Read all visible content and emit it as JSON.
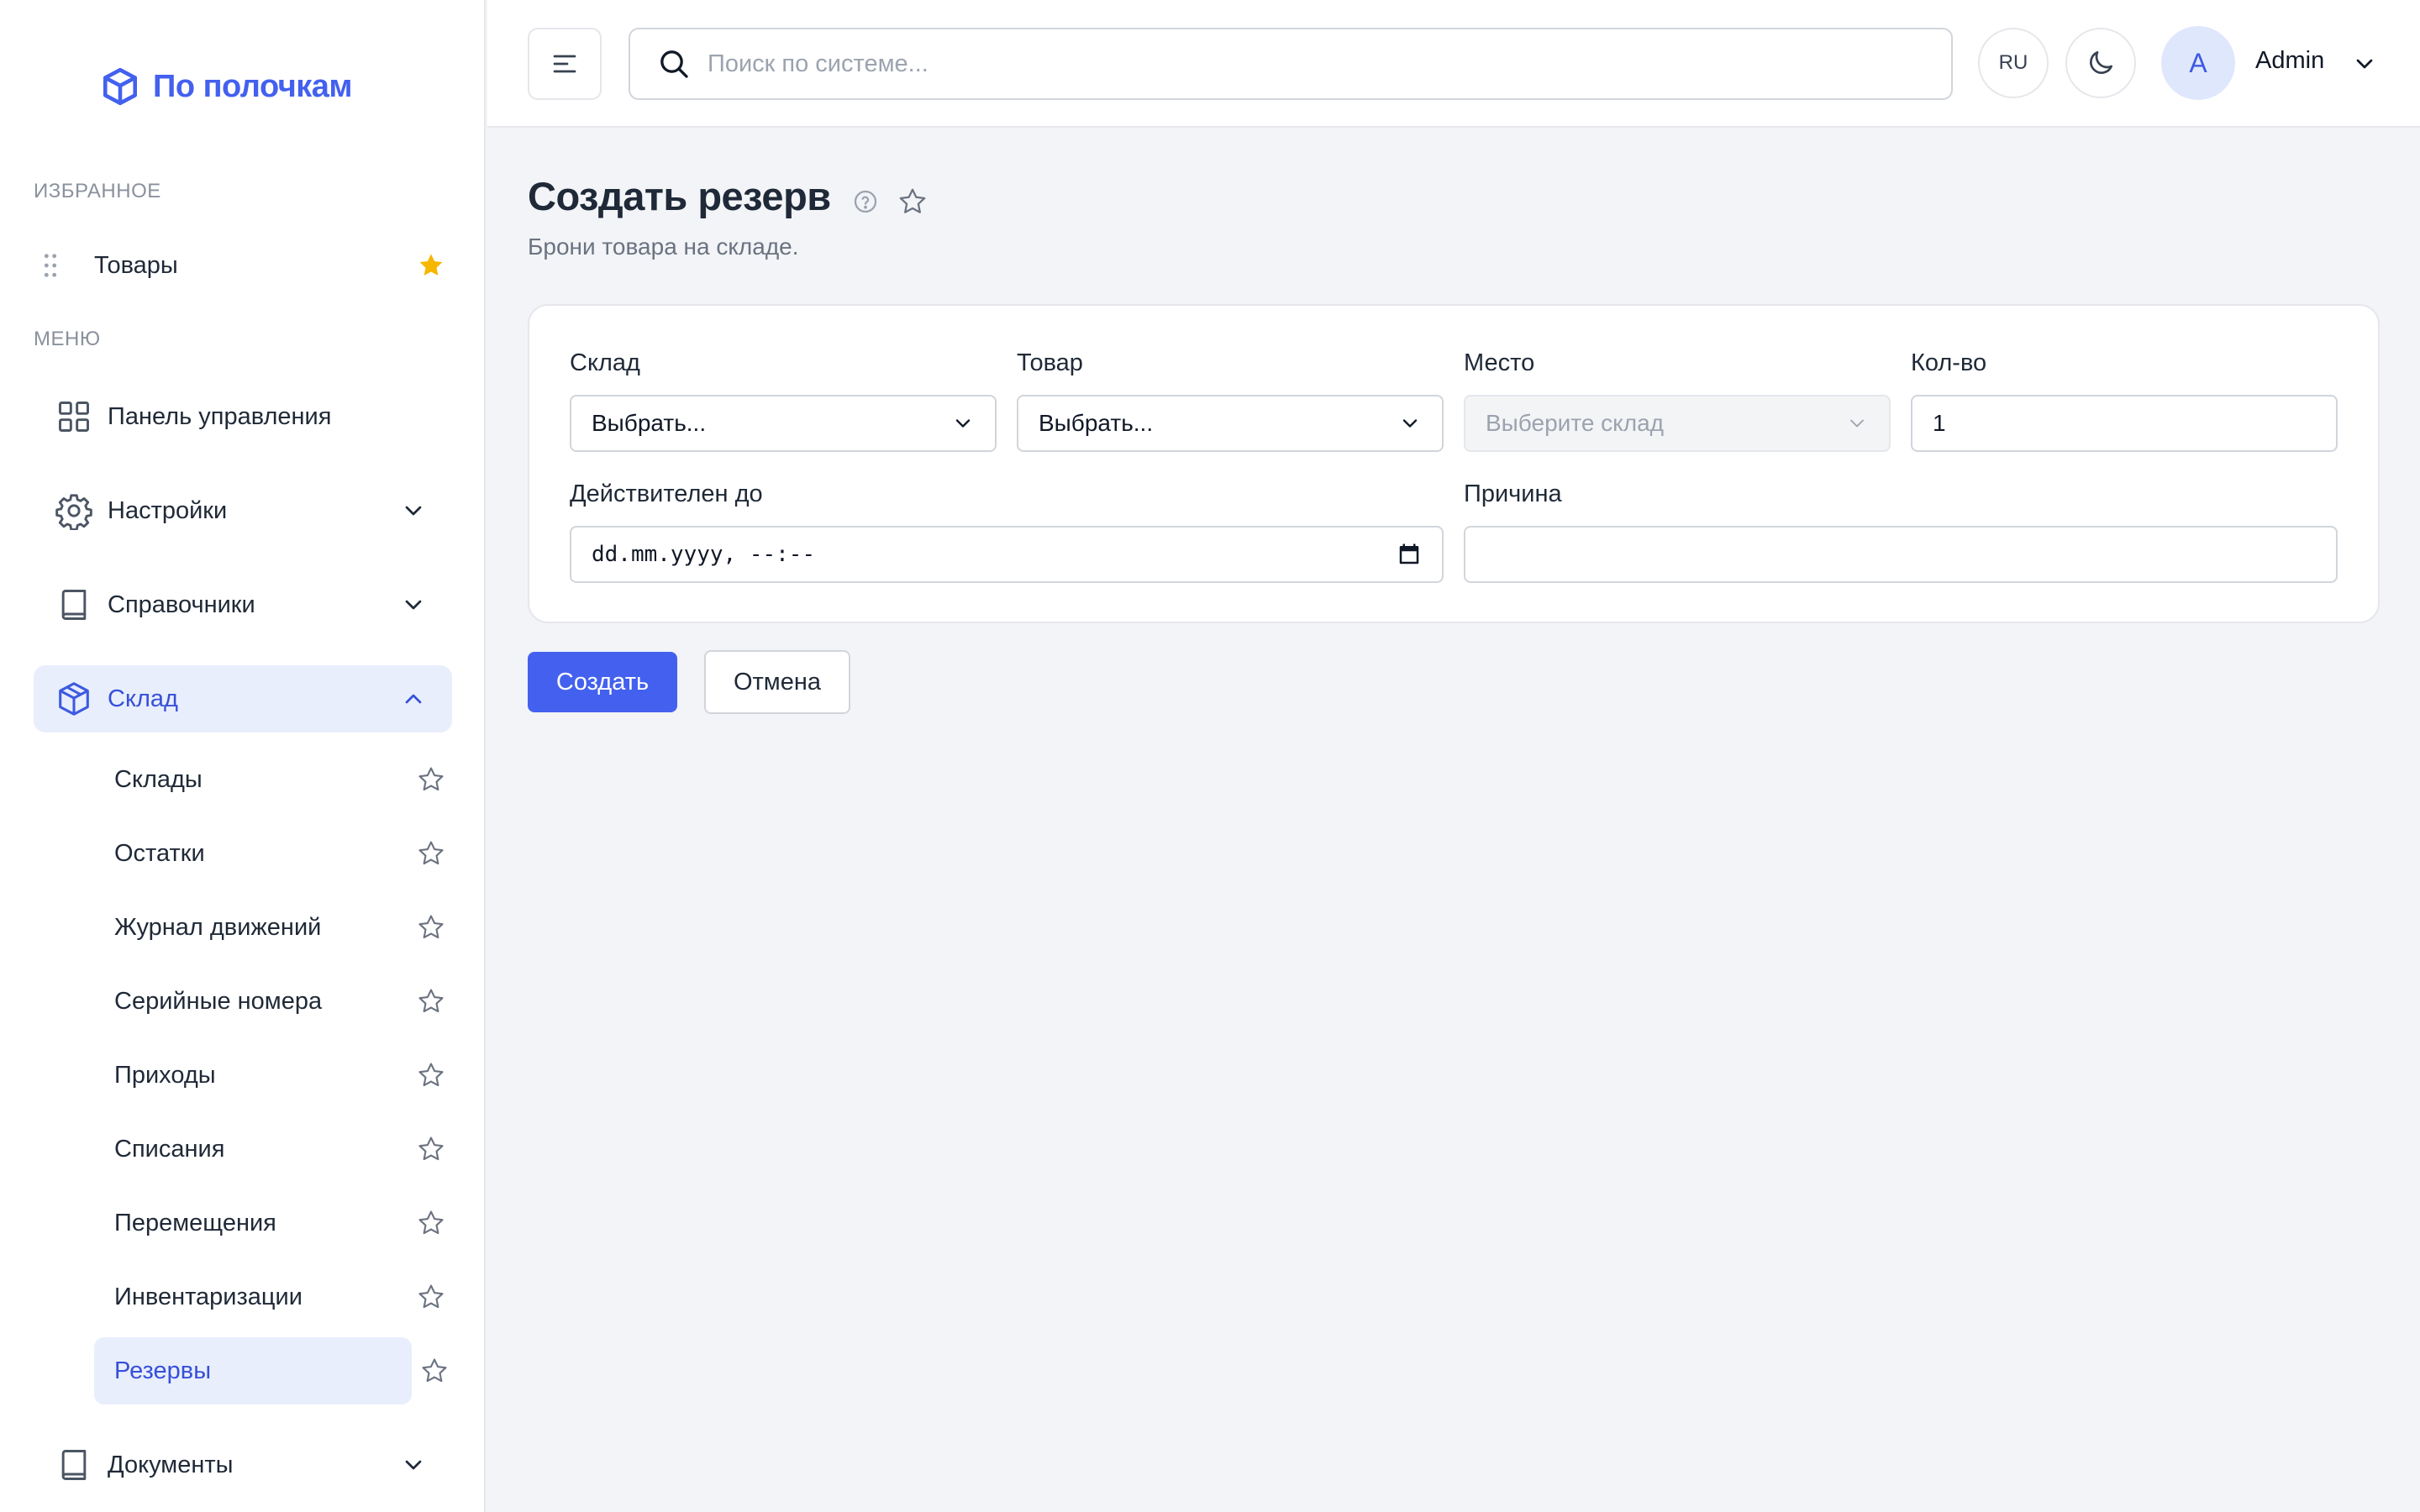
{
  "app": {
    "name": "По полочкам"
  },
  "sidebar": {
    "favorites_label": "ИЗБРАННОЕ",
    "favorites": [
      {
        "label": "Товары",
        "starred": true
      }
    ],
    "menu_label": "МЕНЮ",
    "items": [
      {
        "label": "Панель управления",
        "icon": "grid-icon"
      },
      {
        "label": "Настройки",
        "icon": "gear-icon",
        "expandable": true
      },
      {
        "label": "Справочники",
        "icon": "book-icon",
        "expandable": true
      },
      {
        "label": "Склад",
        "icon": "box-icon",
        "expandable": true,
        "expanded": true,
        "active": true
      },
      {
        "label": "Документы",
        "icon": "book-icon",
        "expandable": true
      }
    ],
    "warehouse_sub": [
      {
        "label": "Склады"
      },
      {
        "label": "Остатки"
      },
      {
        "label": "Журнал движений"
      },
      {
        "label": "Серийные номера"
      },
      {
        "label": "Приходы"
      },
      {
        "label": "Списания"
      },
      {
        "label": "Перемещения"
      },
      {
        "label": "Инвентаризации"
      },
      {
        "label": "Резервы",
        "active": true
      }
    ]
  },
  "topbar": {
    "search_placeholder": "Поиск по системе...",
    "search_value": "",
    "language": "RU",
    "user": {
      "initial": "A",
      "name": "Admin"
    }
  },
  "page": {
    "title": "Создать резерв",
    "subtitle": "Брони товара на складе."
  },
  "form": {
    "warehouse": {
      "label": "Склад",
      "value": "Выбрать..."
    },
    "product": {
      "label": "Товар",
      "value": "Выбрать..."
    },
    "place": {
      "label": "Место",
      "value": "Выберите склад",
      "disabled": true
    },
    "qty": {
      "label": "Кол-во",
      "value": "1"
    },
    "valid_until": {
      "label": "Действителен до",
      "value": "dd.mm.yyyy, --:--"
    },
    "reason": {
      "label": "Причина",
      "value": ""
    }
  },
  "actions": {
    "create": "Создать",
    "cancel": "Отмена"
  },
  "colors": {
    "accent": "#4361ee",
    "star_active": "#f5b700",
    "active_bg": "#e8eefc"
  }
}
